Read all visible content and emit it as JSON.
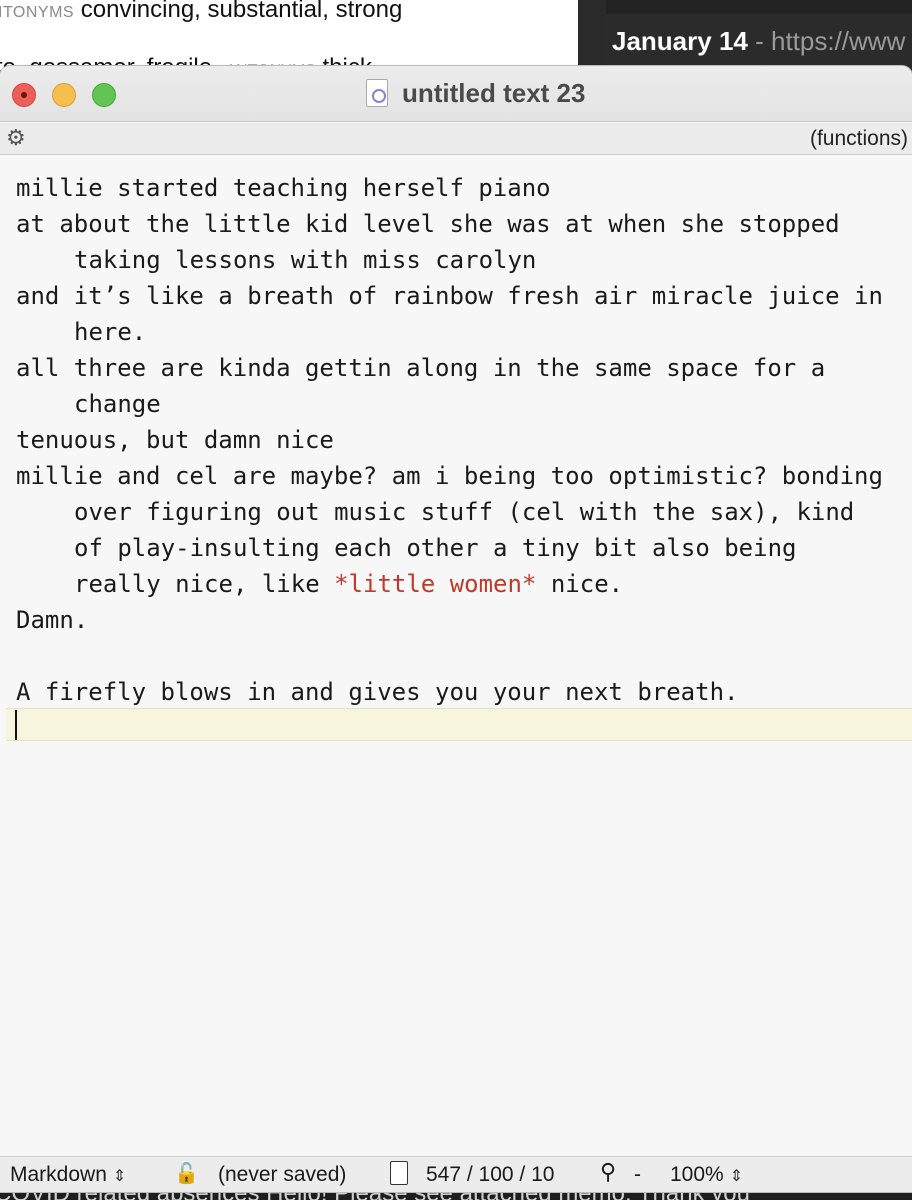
{
  "background": {
    "left_line1_tag": "ITONYMS",
    "left_line1_text": " convincing, substantial, strong",
    "left_line2_prefix": "to, gossamer, fragile, ",
    "left_line2_tag": "ANTONYMS",
    "left_line2_suffix": " thick",
    "right_date": "January 14",
    "right_url": " - https://www",
    "bottom_text": "COVID related absences   Hello! Please see attached memo. Thank you"
  },
  "window": {
    "title": "untitled text 23",
    "functions_label": "(functions)"
  },
  "document": {
    "lines": [
      "millie started teaching herself piano",
      "at about the little kid level she was at when she stopped taking lessons with miss carolyn",
      "and it’s like a breath of rainbow fresh air miracle juice in here.",
      "all three are kinda gettin along in the same space for a change",
      "tenuous, but damn nice",
      "millie and cel are maybe? am i being too optimistic? bonding over figuring out music stuff (cel with the sax), kind of play-insulting each other a tiny bit also being really nice, like ",
      "*little women*",
      " nice.",
      "Damn.",
      "",
      "A firefly blows in and gives you your next breath."
    ]
  },
  "status": {
    "mode": "Markdown",
    "saved": "(never saved)",
    "counts": "547 / 100 / 10",
    "search_minus": "-",
    "zoom": "100%"
  },
  "colors": {
    "emphasis": "#c0392b",
    "current_line": "#f7f5dd",
    "close": "#ec5f58",
    "minimize": "#f4bf4f",
    "maximize": "#61c454"
  },
  "icons": [
    "gear-icon",
    "lock-icon",
    "document-icon",
    "magnifier-icon",
    "chevron-updown-icon"
  ]
}
